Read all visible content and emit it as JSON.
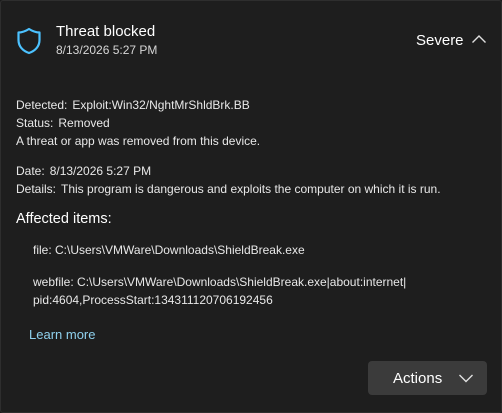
{
  "header": {
    "title": "Threat blocked",
    "timestamp": "8/13/2026 5:27 PM",
    "severity": "Severe",
    "icon": "shield-icon",
    "collapse_icon": "chevron-up-icon"
  },
  "details": {
    "detected_label": "Detected:",
    "detected_value": "Exploit:Win32/NghtMrShldBrk.BB",
    "status_label": "Status:",
    "status_value": "Removed",
    "status_message": "A threat or app was removed from this device.",
    "date_label": "Date:",
    "date_value": "8/13/2026 5:27 PM",
    "details_label": "Details:",
    "details_value": "This program is dangerous and exploits the computer on which it is run."
  },
  "affected": {
    "heading": "Affected items:",
    "items": [
      "file: C:\\Users\\VMWare\\Downloads\\ShieldBreak.exe",
      "webfile: C:\\Users\\VMWare\\Downloads\\ShieldBreak.exe|about:internet|",
      "pid:4604,ProcessStart:134311120706192456"
    ]
  },
  "links": {
    "learn_more": "Learn more"
  },
  "actions": {
    "label": "Actions",
    "icon": "chevron-down-icon"
  },
  "colors": {
    "background": "#1e1e1e",
    "accent_shield": "#4cc2ff",
    "link": "#8fd1ee",
    "button": "#3b3b3b"
  }
}
